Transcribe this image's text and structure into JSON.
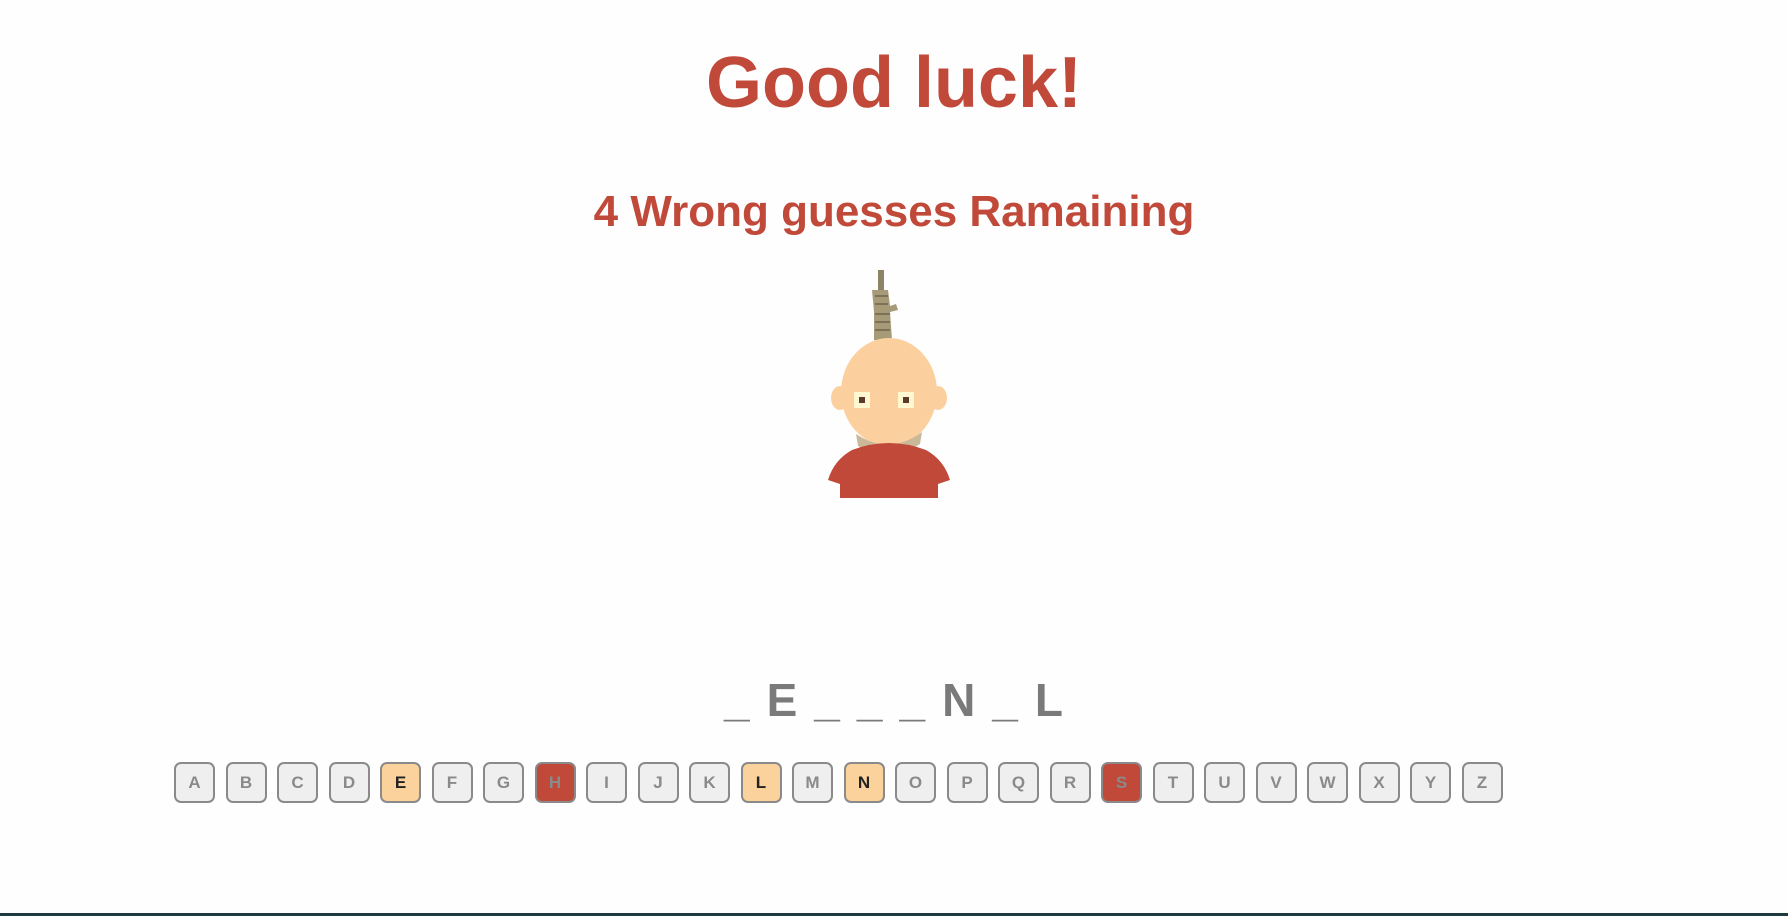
{
  "header": {
    "title": "Good luck!",
    "remaining": "4 Wrong guesses Ramaining"
  },
  "game": {
    "wrong_guesses_remaining": 4,
    "word_display": [
      "_",
      "E",
      "_",
      "_",
      "_",
      "N",
      "_",
      "L"
    ]
  },
  "keyboard": {
    "keys": [
      {
        "letter": "A",
        "state": "unused"
      },
      {
        "letter": "B",
        "state": "unused"
      },
      {
        "letter": "C",
        "state": "unused"
      },
      {
        "letter": "D",
        "state": "unused"
      },
      {
        "letter": "E",
        "state": "correct"
      },
      {
        "letter": "F",
        "state": "unused"
      },
      {
        "letter": "G",
        "state": "unused"
      },
      {
        "letter": "H",
        "state": "wrong"
      },
      {
        "letter": "I",
        "state": "unused"
      },
      {
        "letter": "J",
        "state": "unused"
      },
      {
        "letter": "K",
        "state": "unused"
      },
      {
        "letter": "L",
        "state": "correct"
      },
      {
        "letter": "M",
        "state": "unused"
      },
      {
        "letter": "N",
        "state": "correct"
      },
      {
        "letter": "O",
        "state": "unused"
      },
      {
        "letter": "P",
        "state": "unused"
      },
      {
        "letter": "Q",
        "state": "unused"
      },
      {
        "letter": "R",
        "state": "unused"
      },
      {
        "letter": "S",
        "state": "wrong"
      },
      {
        "letter": "T",
        "state": "unused"
      },
      {
        "letter": "U",
        "state": "unused"
      },
      {
        "letter": "V",
        "state": "unused"
      },
      {
        "letter": "W",
        "state": "unused"
      },
      {
        "letter": "X",
        "state": "unused"
      },
      {
        "letter": "Y",
        "state": "unused"
      },
      {
        "letter": "Z",
        "state": "unused"
      }
    ]
  },
  "colors": {
    "accent": "#c0493a",
    "correct": "#fbd19c",
    "wrong": "#c0493a",
    "key_border": "#8a8a8a",
    "word_text": "#7a7a7a",
    "skin": "#fcd09e",
    "rope": "#a69a78",
    "shirt": "#c0493a"
  },
  "icons": {
    "figure": "hangman-figure-icon"
  }
}
